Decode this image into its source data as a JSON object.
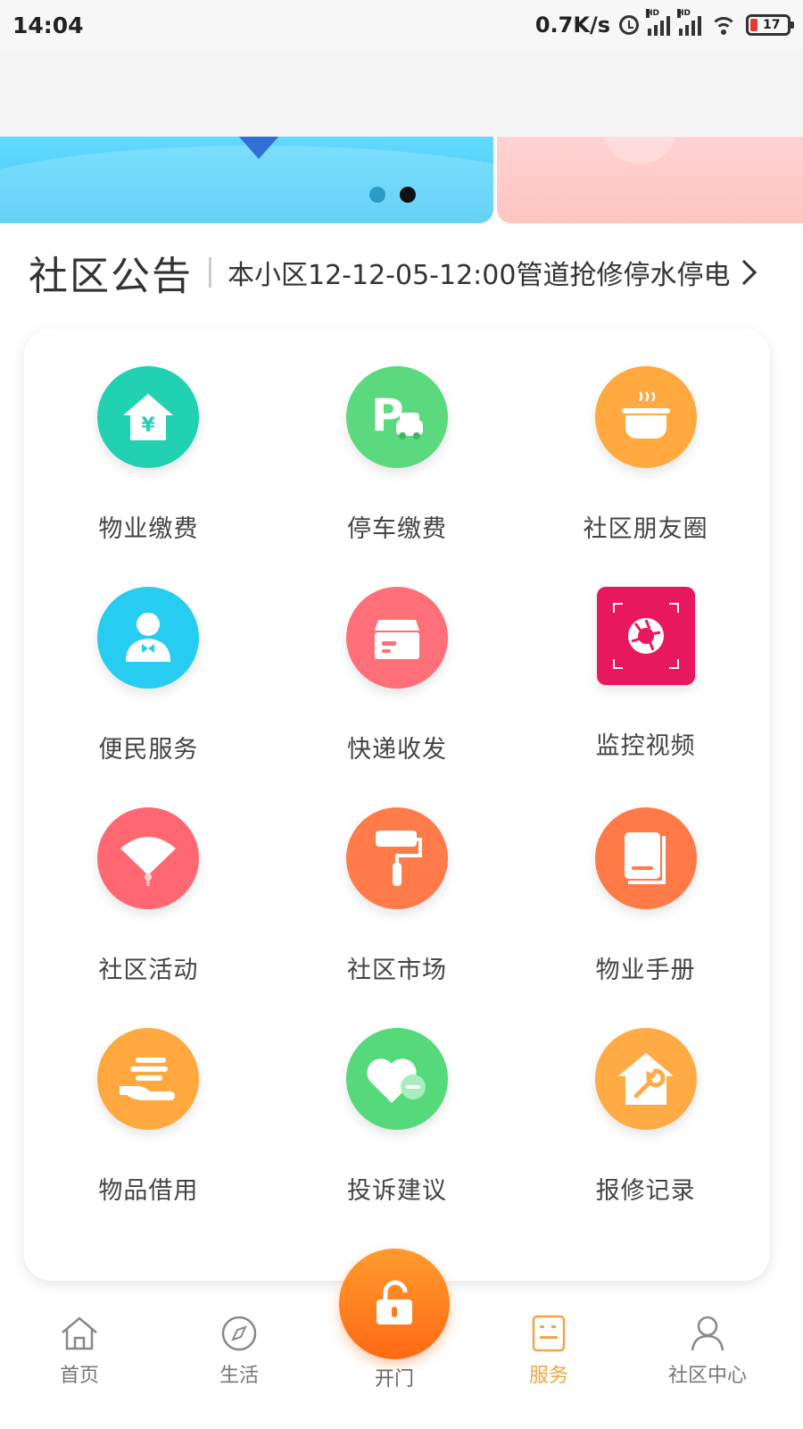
{
  "status_bar": {
    "time": "14:04",
    "network_speed": "0.7K/s",
    "signal_label": "HD",
    "battery": "17"
  },
  "banner": {
    "slides_count": 2,
    "active_slide": 2
  },
  "notice": {
    "title": "社区公告",
    "text": "本小区12-12-05-12:00管道抢修停水停电"
  },
  "services": [
    {
      "label": "物业缴费",
      "icon": "property-fee-icon",
      "color": "#21d1b2"
    },
    {
      "label": "停车缴费",
      "icon": "parking-fee-icon",
      "color": "#5bd97e"
    },
    {
      "label": "社区朋友圈",
      "icon": "community-moments-icon",
      "color": "#ffa93e"
    },
    {
      "label": "便民服务",
      "icon": "convenience-service-icon",
      "color": "#27cdf0"
    },
    {
      "label": "快递收发",
      "icon": "express-delivery-icon",
      "color": "#ff6f78"
    },
    {
      "label": "监控视频",
      "icon": "surveillance-video-icon",
      "color": "#e8185f"
    },
    {
      "label": "社区活动",
      "icon": "community-activity-icon",
      "color": "#ff6872"
    },
    {
      "label": "社区市场",
      "icon": "community-market-icon",
      "color": "#ff7b4a"
    },
    {
      "label": "物业手册",
      "icon": "property-manual-icon",
      "color": "#ff7a47"
    },
    {
      "label": "物品借用",
      "icon": "item-borrowing-icon",
      "color": "#ffa83f"
    },
    {
      "label": "投诉建议",
      "icon": "complaint-suggestion-icon",
      "color": "#55d97b"
    },
    {
      "label": "报修记录",
      "icon": "repair-record-icon",
      "color": "#ffab45"
    }
  ],
  "bottom_nav": {
    "home": "首页",
    "life": "生活",
    "open_door": "开门",
    "service": "服务",
    "community_center": "社区中心",
    "active_color": "#f2a646"
  }
}
